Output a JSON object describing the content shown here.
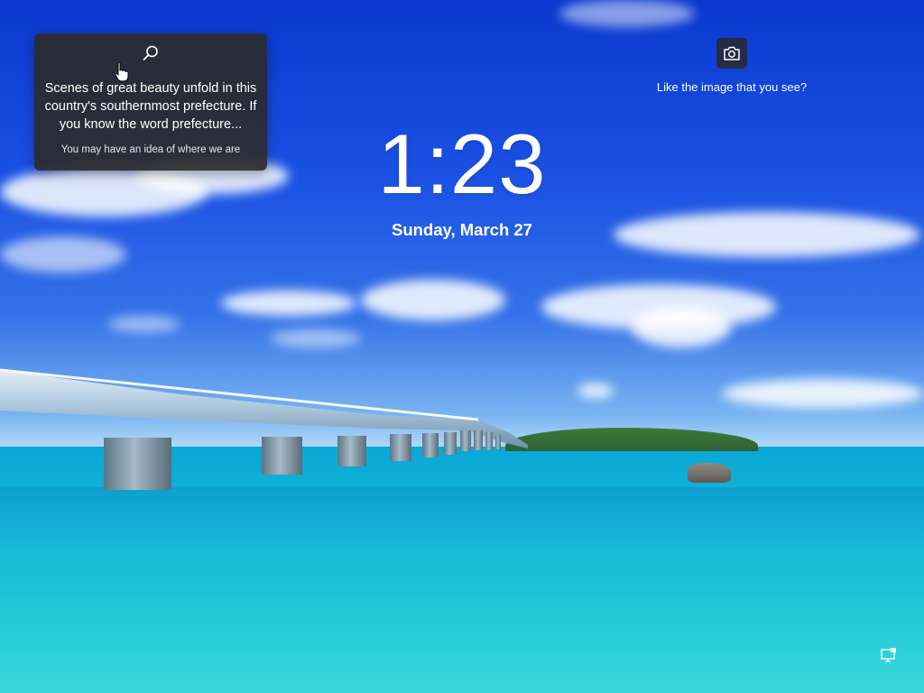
{
  "lockscreen": {
    "info_card": {
      "icon": "search-icon",
      "text": "Scenes of great beauty unfold in this country's southernmost prefecture. If you know the word prefecture...",
      "hint": "You may have an idea of where we are"
    },
    "camera": {
      "icon": "camera-icon",
      "label": "Like the image that you see?"
    },
    "time": "1:23",
    "date": "Sunday, March 27",
    "status_icons": [
      "network-icon"
    ],
    "colors": {
      "card_background": "#2b2b2b",
      "text": "#ffffff",
      "sky": "#1b52e4",
      "sea": "#12b4d8"
    }
  }
}
